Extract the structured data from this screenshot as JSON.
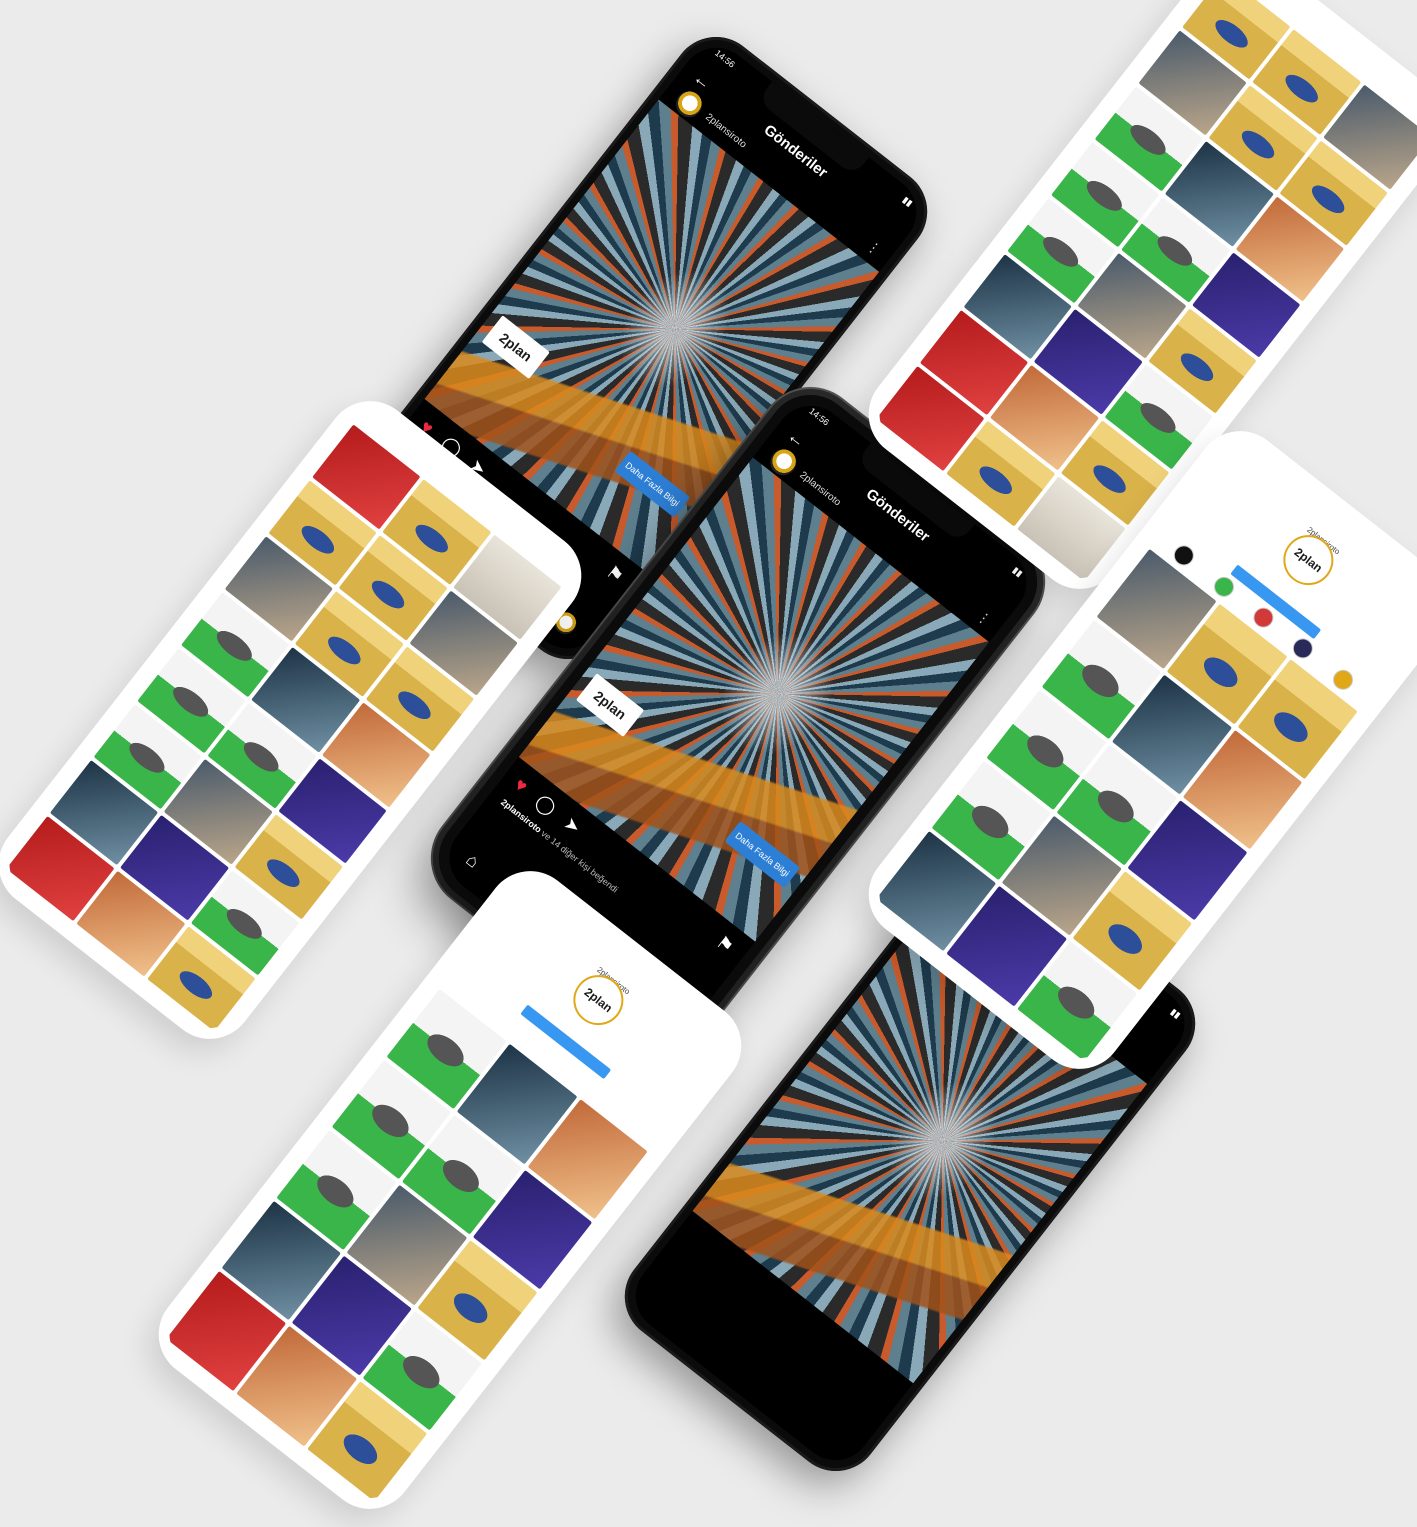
{
  "post_screen": {
    "status_time": "14:56",
    "title": "Gönderiler",
    "username": "2plansiroto",
    "caption_user": "2plansiroto",
    "caption_text": "ve 14 diğer kişi beğendi",
    "comment_user": "2plansiroto",
    "cta_label": "Daha Fazla Bilgi",
    "brand_logo": "2plan"
  },
  "profile_screen": {
    "header_label": "2plansiroto",
    "logo_text": "2plan"
  },
  "colors": {
    "background": "#ebebeb",
    "accent_gold": "#e0a818",
    "like_red": "#ed2a3f",
    "cta_blue": "#2d7fd6"
  },
  "grid_tiles": [
    "red",
    "gold",
    "note",
    "gold",
    "gold",
    "photo",
    "photo",
    "gold",
    "gold",
    "green",
    "photo2",
    "warm",
    "green",
    "green",
    "purple",
    "green",
    "photo",
    "gold",
    "photo2",
    "purple",
    "green",
    "red",
    "warm",
    "gold"
  ]
}
